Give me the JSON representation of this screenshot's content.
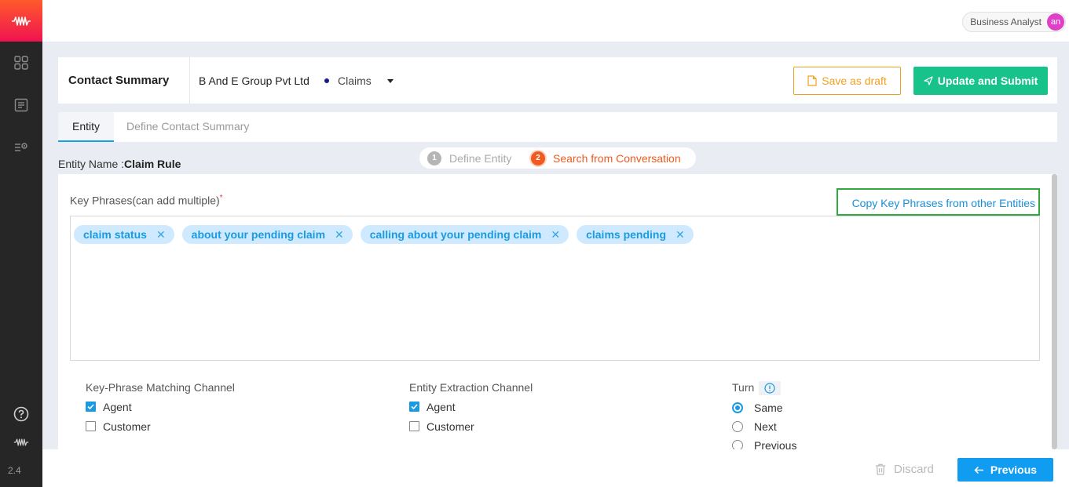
{
  "app": {
    "logo_icon": "waveform-icon",
    "version": "2.4",
    "brand_gradient": [
      "#ff5a2c",
      "#f0124f"
    ]
  },
  "rail": {
    "items": [
      {
        "icon": "grid-icon"
      },
      {
        "icon": "document-list-icon"
      },
      {
        "icon": "settings-list-icon"
      }
    ],
    "help_icon": "help-circle-icon",
    "bottom_logo_icon": "waveform-icon"
  },
  "topbar": {
    "role": "Business Analyst",
    "avatar_initials": "an",
    "avatar_color": "#e040c8"
  },
  "header": {
    "title": "Contact Summary",
    "company": "B And E Group Pvt Ltd",
    "category": "Claims",
    "save_draft_label": "Save as draft",
    "submit_label": "Update and Submit",
    "accent_draft": "#f0a020",
    "accent_submit": "#17c38b"
  },
  "tabs": [
    {
      "label": "Entity",
      "active": true
    },
    {
      "label": "Define Contact Summary",
      "active": false
    }
  ],
  "stepper": {
    "steps": [
      {
        "num": "1",
        "label": "Define Entity",
        "state": "done"
      },
      {
        "num": "2",
        "label": "Search from Conversation",
        "state": "current"
      }
    ]
  },
  "entity": {
    "label": "Entity Name :",
    "value": "Claim Rule"
  },
  "key_phrases": {
    "label": "Key Phrases(can add multiple)",
    "required_mark": "*",
    "copy_link": "Copy Key Phrases from other Entities",
    "chips": [
      "claim status",
      "about your pending claim",
      "calling about your pending claim",
      "claims pending"
    ],
    "remove_icon": "close-icon"
  },
  "matching_channel": {
    "title": "Key-Phrase Matching Channel",
    "options": [
      {
        "label": "Agent",
        "checked": true
      },
      {
        "label": "Customer",
        "checked": false
      }
    ]
  },
  "extraction_channel": {
    "title": "Entity Extraction Channel",
    "options": [
      {
        "label": "Agent",
        "checked": true
      },
      {
        "label": "Customer",
        "checked": false
      }
    ]
  },
  "turn": {
    "title": "Turn",
    "info_icon": "info-icon",
    "options": [
      {
        "label": "Same",
        "selected": true
      },
      {
        "label": "Next",
        "selected": false
      },
      {
        "label": "Previous",
        "selected": false
      }
    ]
  },
  "footer": {
    "discard_label": "Discard",
    "previous_label": "Previous",
    "accent_previous": "#109cf0"
  }
}
